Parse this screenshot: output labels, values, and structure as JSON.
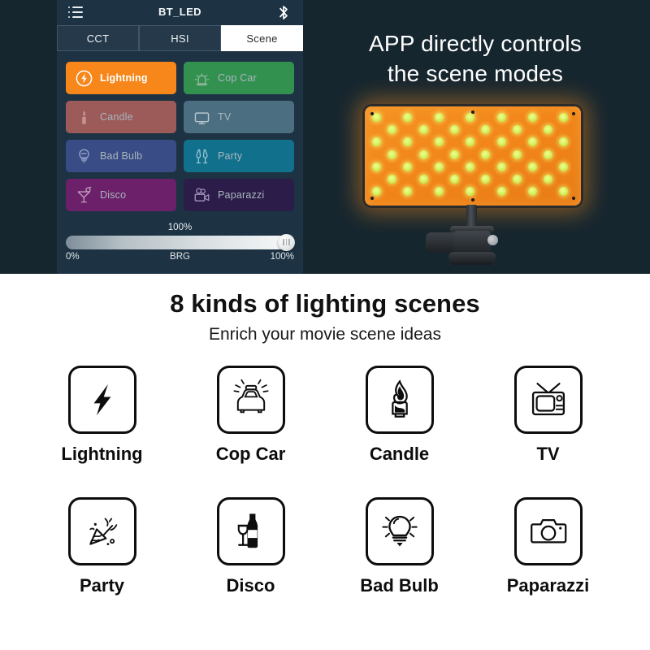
{
  "app": {
    "title": "BT_LED",
    "list_icon": "list-menu-icon",
    "bluetooth_icon": "bluetooth-icon",
    "tabs": [
      {
        "label": "CCT",
        "active": false
      },
      {
        "label": "HSI",
        "active": false
      },
      {
        "label": "Scene",
        "active": true
      }
    ],
    "scenes": [
      {
        "label": "Lightning",
        "icon": "lightning-bolt-icon",
        "color": "#f7861b",
        "selected": true
      },
      {
        "label": "Cop Car",
        "icon": "police-siren-icon",
        "color": "#339150",
        "selected": false
      },
      {
        "label": "Candle",
        "icon": "candle-icon",
        "color": "#9c5a59",
        "selected": false
      },
      {
        "label": "TV",
        "icon": "television-icon",
        "color": "#4b6e80",
        "selected": false
      },
      {
        "label": "Bad Bulb",
        "icon": "light-bulb-icon",
        "color": "#3a4c85",
        "selected": false
      },
      {
        "label": "Party",
        "icon": "champagne-glasses-icon",
        "color": "#11718c",
        "selected": false
      },
      {
        "label": "Disco",
        "icon": "cocktail-glass-icon",
        "color": "#6b2069",
        "selected": false
      },
      {
        "label": "Paparazzi",
        "icon": "movie-camera-icon",
        "color": "#2b1c4a",
        "selected": false
      }
    ],
    "slider": {
      "value_label": "100%",
      "min_label": "0%",
      "name_label": "BRG",
      "max_label": "100%",
      "fill_percent": 100
    }
  },
  "hero": {
    "headline_line1": "APP directly controls",
    "headline_line2": "the scene modes",
    "product_icon": "led-light-panel"
  },
  "lower": {
    "title": "8 kinds of lighting scenes",
    "subtitle": "Enrich your movie scene ideas",
    "scene_icons": [
      {
        "label": "Lightning",
        "icon": "lightning-bolt-icon"
      },
      {
        "label": "Cop Car",
        "icon": "police-car-icon"
      },
      {
        "label": "Candle",
        "icon": "candle-icon"
      },
      {
        "label": "TV",
        "icon": "retro-television-icon"
      },
      {
        "label": "Party",
        "icon": "party-popper-icon"
      },
      {
        "label": "Disco",
        "icon": "wine-bottle-glass-icon"
      },
      {
        "label": "Bad Bulb",
        "icon": "light-bulb-icon"
      },
      {
        "label": "Paparazzi",
        "icon": "camera-icon"
      }
    ]
  },
  "colors": {
    "hero_background": "#16262f",
    "app_background": "#1d3243",
    "accent_orange": "#f7861b",
    "lower_background": "#ffffff"
  }
}
